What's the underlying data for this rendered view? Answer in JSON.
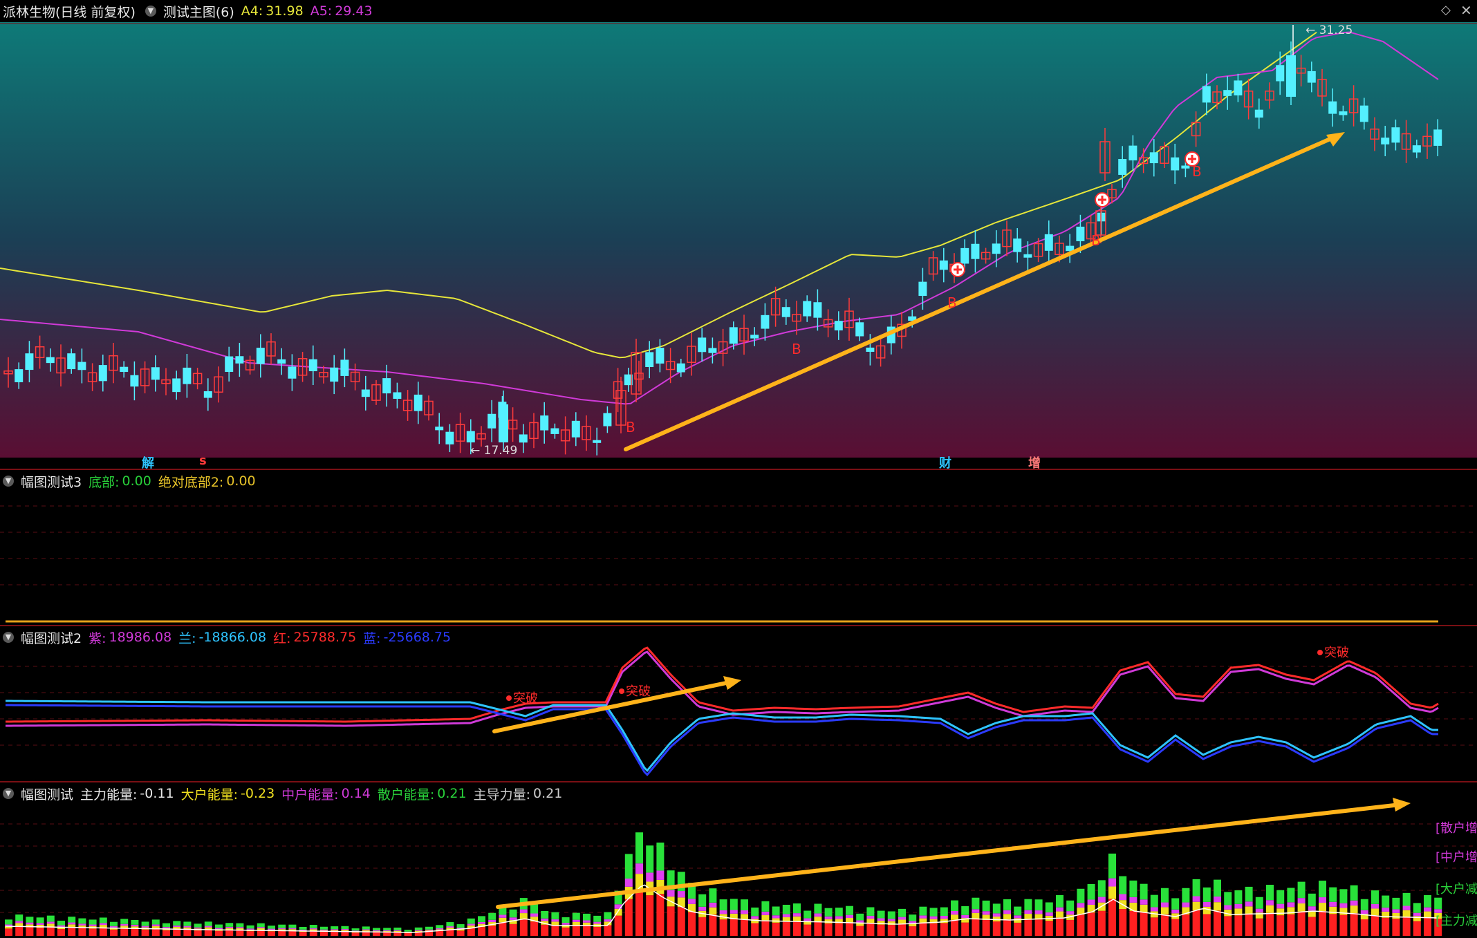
{
  "main": {
    "stock_name": "派林生物(日线 前复权)",
    "indicator": "测试主图(6)",
    "a4_label": "A4:",
    "a4_value": "31.98",
    "a5_label": "A5:",
    "a5_value": "29.43",
    "high_label": "31.25",
    "low_label": "17.49",
    "signal_b": "B",
    "signal_s": "S",
    "event_labels": [
      {
        "text": "解",
        "color": "#2ec4ff"
      },
      {
        "text": "s",
        "color": "#ff3b3b"
      },
      {
        "text": "财",
        "color": "#2ec4ff"
      },
      {
        "text": "增",
        "color": "#ff7a7a"
      }
    ],
    "colors": {
      "up": "#ff3b3b",
      "down": "#54f0ff",
      "ma_yellow": "#e6e63a",
      "ma_magenta": "#d03ad8",
      "arrow": "#ffb31a"
    }
  },
  "panel1": {
    "title": "幅图测试3",
    "label1": "底部:",
    "value1": "0.00",
    "label2": "绝对底部2:",
    "value2": "0.00"
  },
  "panel2": {
    "title": "幅图测试2",
    "purple_label": "紫:",
    "purple_value": "18986.08",
    "blue_label": "兰:",
    "blue_value": "-18866.08",
    "red_label": "红:",
    "red_value": "25788.75",
    "darkblue_label": "蓝:",
    "darkblue_value": "-25668.75",
    "breakout": "突破"
  },
  "panel3": {
    "title": "幅图测试",
    "main_label": "主力能量:",
    "main_value": "-0.11",
    "big_label": "大户能量:",
    "big_value": "-0.23",
    "mid_label": "中户能量:",
    "mid_value": "0.14",
    "retail_label": "散户能量:",
    "retail_value": "0.21",
    "lead_label": "主导力量:",
    "lead_value": "0.21",
    "side_labels": [
      {
        "text": "[散户增",
        "color": "#d03ad8"
      },
      {
        "text": "[中户增",
        "color": "#d03ad8"
      },
      {
        "text": "[大户减",
        "color": "#29d13a"
      },
      {
        "text": "[主力减",
        "color": "#29d13a"
      }
    ]
  }
}
